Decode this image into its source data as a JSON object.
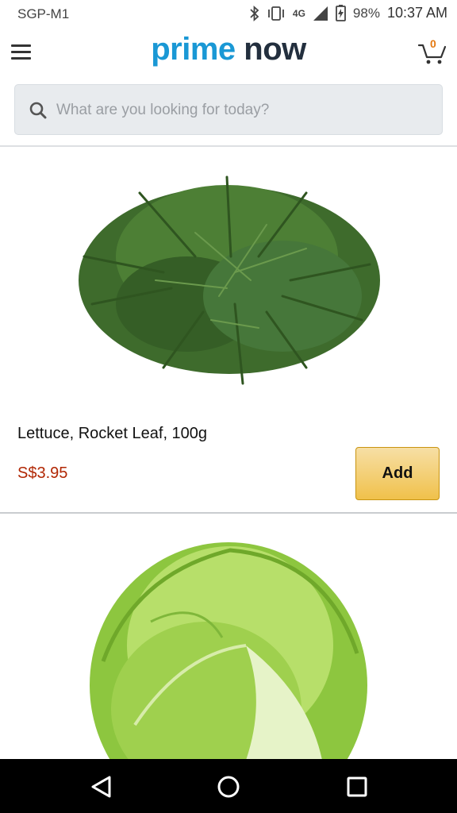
{
  "status_bar": {
    "carrier": "SGP-M1",
    "network": "4G",
    "battery": "98%",
    "time": "10:37 AM",
    "icons": [
      "bluetooth-icon",
      "vibrate-icon",
      "signal-icon",
      "battery-icon"
    ]
  },
  "header": {
    "logo_prime": "prime",
    "logo_now": "now",
    "cart_count": "0",
    "icons": [
      "menu-icon",
      "cart-icon"
    ]
  },
  "search": {
    "placeholder": "What are you looking for today?",
    "value": "",
    "icon": "search-icon"
  },
  "products": [
    {
      "name": "Lettuce, Rocket Leaf, 100g",
      "price": "S$3.95",
      "add_label": "Add",
      "image": "rocket-leaf-image"
    },
    {
      "image": "iceberg-lettuce-image"
    }
  ],
  "nav_bar": {
    "icons": [
      "back-icon",
      "home-icon",
      "recents-icon"
    ]
  },
  "colors": {
    "prime_blue": "#1a98d5",
    "now_dark": "#232f3e",
    "price_red": "#b12704",
    "add_button": "#f0c14b",
    "cart_count": "#e47911"
  }
}
